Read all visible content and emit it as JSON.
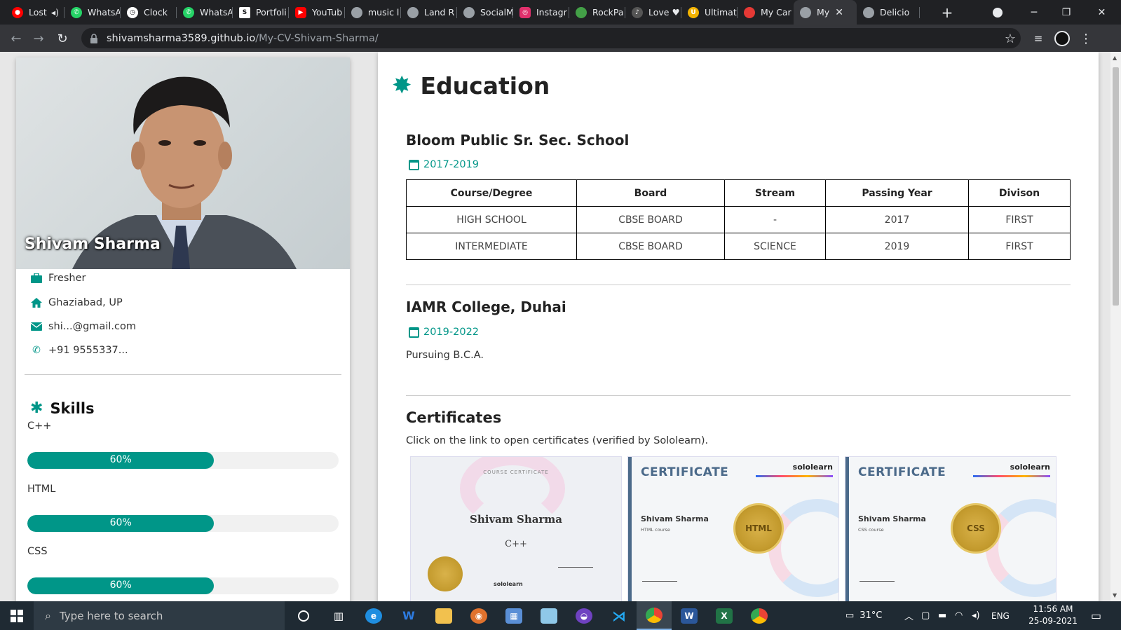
{
  "browser": {
    "tabs": [
      {
        "label": "Lost",
        "icon": "youtube-recording-icon",
        "color": "#ff0000",
        "muted": true
      },
      {
        "label": "WhatsA",
        "icon": "whatsapp-icon",
        "color": "#25d366"
      },
      {
        "label": "Clock",
        "icon": "clock-icon",
        "color": "#ffffff"
      },
      {
        "label": "WhatsA",
        "icon": "whatsapp-icon",
        "color": "#25d366"
      },
      {
        "label": "Portfoli",
        "icon": "portfolio-s-icon",
        "color": "#ffffff"
      },
      {
        "label": "YouTub",
        "icon": "youtube-icon",
        "color": "#ff0000"
      },
      {
        "label": "music l",
        "icon": "globe-icon",
        "color": "#9aa0a6"
      },
      {
        "label": "Land R",
        "icon": "globe-icon",
        "color": "#9aa0a6"
      },
      {
        "label": "SocialM",
        "icon": "globe-icon",
        "color": "#9aa0a6"
      },
      {
        "label": "Instagr",
        "icon": "instagram-icon",
        "color": "#e1306c"
      },
      {
        "label": "RockPa",
        "icon": "rockpaper-icon",
        "color": "#43a047"
      },
      {
        "label": "Love",
        "icon": "love-icon",
        "color": "#ffffff"
      },
      {
        "label": "Ultimat",
        "icon": "ultimate-icon",
        "color": "#f4b400"
      },
      {
        "label": "My Car",
        "icon": "mycar-icon",
        "color": "#e53935"
      },
      {
        "label": "My",
        "icon": "globe-icon",
        "color": "#9aa0a6",
        "active": true
      },
      {
        "label": "Delicio",
        "icon": "globe-icon",
        "color": "#9aa0a6"
      }
    ],
    "url_host": "shivamsharma3589.github.io",
    "url_path": "/My-CV-Shivam-Sharma/"
  },
  "profile": {
    "name": "Shivam Sharma",
    "job": "Fresher",
    "location": "Ghaziabad, UP",
    "email": "shi...@gmail.com",
    "phone": "+91 9555337..."
  },
  "skills": {
    "title": "Skills",
    "items": [
      {
        "name": "C++",
        "percent": 60,
        "label": "60%"
      },
      {
        "name": "HTML",
        "percent": 60,
        "label": "60%"
      },
      {
        "name": "CSS",
        "percent": 60,
        "label": "60%"
      }
    ]
  },
  "education": {
    "title": "Education",
    "schools": [
      {
        "name": "Bloom Public Sr. Sec. School",
        "dates": "2017-2019"
      },
      {
        "name": "IAMR College, Duhai",
        "dates": "2019-2022",
        "note": "Pursuing B.C.A."
      }
    ],
    "table": {
      "headers": [
        "Course/Degree",
        "Board",
        "Stream",
        "Passing Year",
        "Divison"
      ],
      "rows": [
        [
          "HIGH SCHOOL",
          "CBSE BOARD",
          "-",
          "2017",
          "FIRST"
        ],
        [
          "INTERMEDIATE",
          "CBSE BOARD",
          "SCIENCE",
          "2019",
          "FIRST"
        ]
      ]
    }
  },
  "certificates": {
    "title": "Certificates",
    "description": "Click on the link to open certificates (verified by Sololearn).",
    "items": [
      {
        "header": "COURSE CERTIFICATE",
        "holder": "Shivam Sharma",
        "course": "C++",
        "issuer": "sololearn"
      },
      {
        "header": "CERTIFICATE",
        "holder": "Shivam Sharma",
        "course": "HTML course",
        "seal": "HTML",
        "issuer": "sololearn"
      },
      {
        "header": "CERTIFICATE",
        "holder": "Shivam Sharma",
        "course": "CSS course",
        "seal": "CSS",
        "issuer": "sololearn"
      }
    ]
  },
  "taskbar": {
    "search_placeholder": "Type here to search",
    "weather": "31°C",
    "language": "ENG",
    "time": "11:56 AM",
    "date": "25-09-2021"
  },
  "colors": {
    "accent": "#009688",
    "taskbar": "#1f2a33",
    "chrome_dark": "#202124"
  }
}
